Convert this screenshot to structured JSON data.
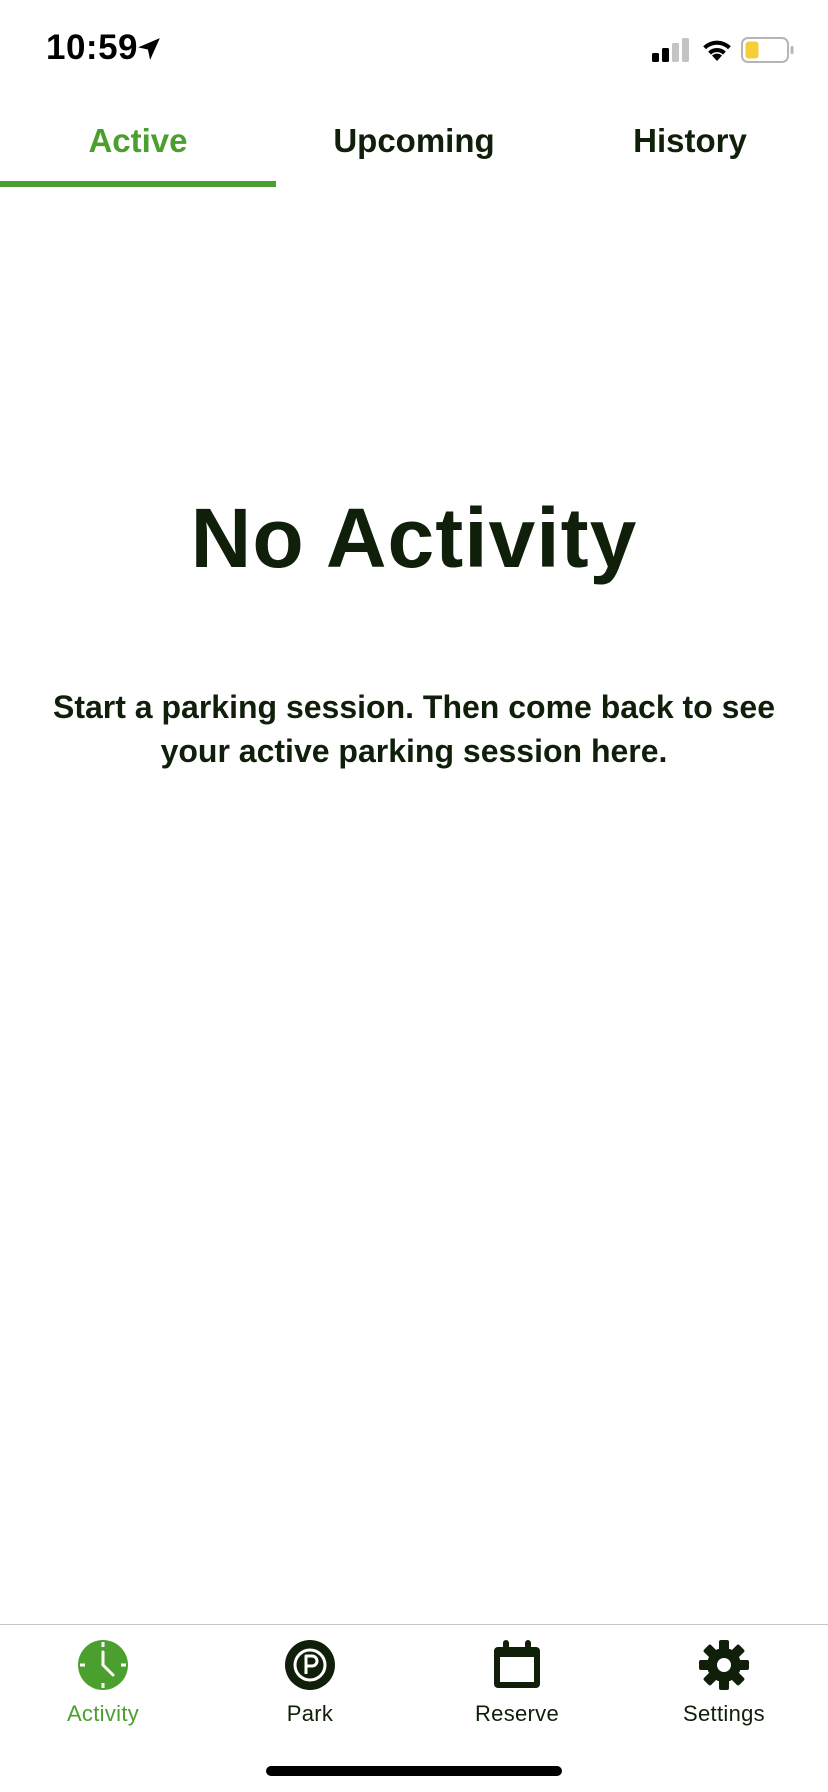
{
  "status_bar": {
    "time": "10:59",
    "icons": [
      "location-arrow-icon",
      "cellular-signal-icon",
      "wifi-icon",
      "battery-low-icon"
    ]
  },
  "tabs": [
    {
      "label": "Active",
      "selected": true
    },
    {
      "label": "Upcoming",
      "selected": false
    },
    {
      "label": "History",
      "selected": false
    }
  ],
  "empty_state": {
    "title": "No Activity",
    "message": "Start a parking session. Then come back to see your active parking session here."
  },
  "bottom_nav": [
    {
      "label": "Activity",
      "icon": "clock-icon",
      "selected": true
    },
    {
      "label": "Park",
      "icon": "parking-p-icon",
      "selected": false
    },
    {
      "label": "Reserve",
      "icon": "calendar-icon",
      "selected": false
    },
    {
      "label": "Settings",
      "icon": "gear-icon",
      "selected": false
    }
  ],
  "colors": {
    "accent": "#4b9f2e",
    "text_dark": "#0f1f0a",
    "battery_fill": "#f5cf3a"
  }
}
